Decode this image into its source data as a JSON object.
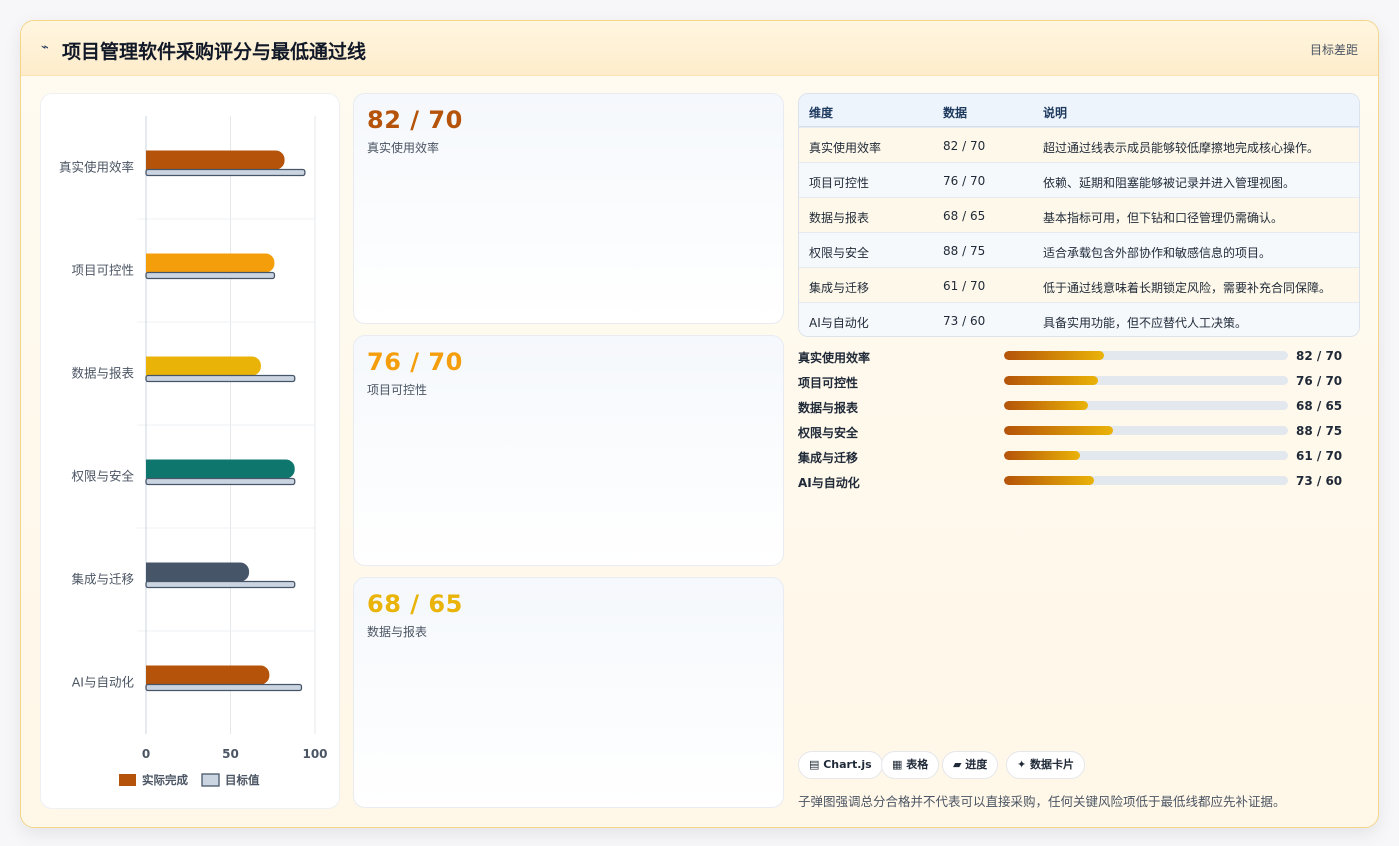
{
  "header": {
    "icon": "lightning-icon",
    "title": "项目管理软件采购评分与最低通过线",
    "link": "目标差距"
  },
  "colors": {
    "bar_actual": [
      "#b45309",
      "#f59e0b",
      "#eab308",
      "#0f766e",
      "#475569",
      "#b45309"
    ],
    "bar_target": "#cbd5e1",
    "card_values": [
      "#b45309",
      "#f59e0b",
      "#eab308"
    ]
  },
  "chart_data": {
    "type": "bar",
    "orientation": "horizontal",
    "categories": [
      "真实使用效率",
      "项目可控性",
      "数据与报表",
      "权限与安全",
      "集成与迁移",
      "AI与自动化"
    ],
    "series": [
      {
        "name": "实际完成",
        "values": [
          82,
          76,
          68,
          88,
          61,
          73
        ]
      },
      {
        "name": "目标值",
        "values": [
          94,
          76,
          88,
          88,
          88,
          92
        ]
      }
    ],
    "xlim": [
      0,
      100
    ],
    "x_ticks": [
      "0",
      "50",
      "100"
    ],
    "legend": "bottom",
    "grid": true
  },
  "cards": [
    {
      "value": "82 / 70",
      "label": "真实使用效率"
    },
    {
      "value": "76 / 70",
      "label": "项目可控性"
    },
    {
      "value": "68 / 65",
      "label": "数据与报表"
    }
  ],
  "table": {
    "headers": [
      "维度",
      "数据",
      "说明"
    ],
    "rows": [
      [
        "真实使用效率",
        "82 / 70",
        "超过通过线表示成员能够较低摩擦地完成核心操作。"
      ],
      [
        "项目可控性",
        "76 / 70",
        "依赖、延期和阻塞能够被记录并进入管理视图。"
      ],
      [
        "数据与报表",
        "68 / 65",
        "基本指标可用，但下钻和口径管理仍需确认。"
      ],
      [
        "权限与安全",
        "88 / 75",
        "适合承载包含外部协作和敏感信息的项目。"
      ],
      [
        "集成与迁移",
        "61 / 70",
        "低于通过线意味着长期锁定风险，需要补充合同保障。"
      ],
      [
        "AI与自动化",
        "73 / 60",
        "具备实用功能，但不应替代人工决策。"
      ]
    ]
  },
  "progress": [
    {
      "label": "真实使用效率",
      "value": "82 / 70",
      "fill": 0.353
    },
    {
      "label": "项目可控性",
      "value": "76 / 70",
      "fill": 0.331
    },
    {
      "label": "数据与报表",
      "value": "68 / 65",
      "fill": 0.296
    },
    {
      "label": "权限与安全",
      "value": "88 / 75",
      "fill": 0.384
    },
    {
      "label": "集成与迁移",
      "value": "61 / 70",
      "fill": 0.266
    },
    {
      "label": "AI与自动化",
      "value": "73 / 60",
      "fill": 0.318
    }
  ],
  "chips": [
    {
      "icon": "chart-icon",
      "label": "▤ Chart.js"
    },
    {
      "icon": "table-icon",
      "label": "▦ 表格"
    },
    {
      "icon": "progress-icon",
      "label": "▰ 进度"
    },
    {
      "icon": "card-icon",
      "label": "✦ 数据卡片"
    }
  ],
  "footer_note": "子弹图强调总分合格并不代表可以直接采购，任何关键风险项低于最低线都应先补证据。"
}
